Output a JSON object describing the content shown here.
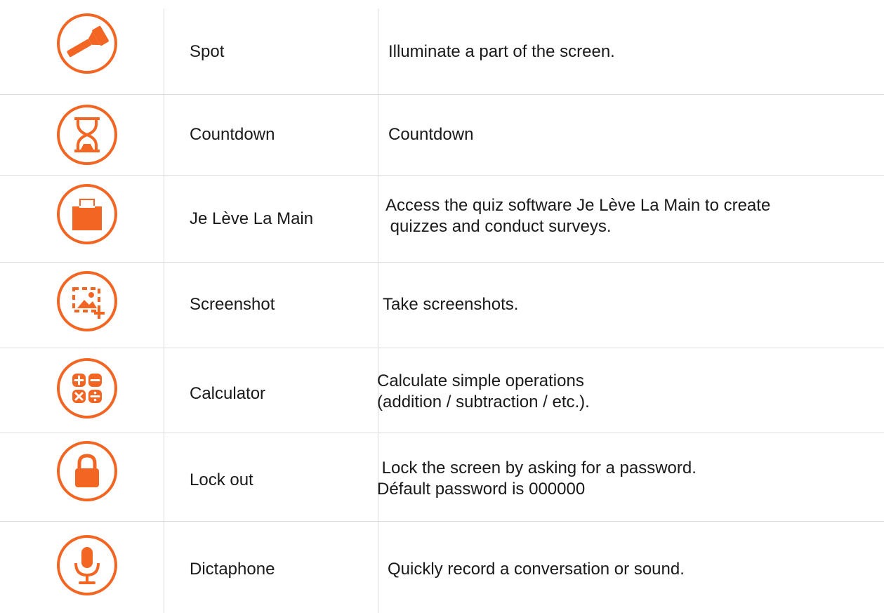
{
  "accent_color": "#f26522",
  "tools": [
    {
      "icon": "flashlight-icon",
      "name": "Spot",
      "description": "Illuminate a part of the screen."
    },
    {
      "icon": "hourglass-icon",
      "name": "Countdown",
      "description": "Countdown"
    },
    {
      "icon": "ballot-box-icon",
      "name": "Je Lève La Main",
      "description": "Access the quiz software Je Lève La Main to create\n quizzes and conduct surveys."
    },
    {
      "icon": "screenshot-icon",
      "name": "Screenshot",
      "description": "Take screenshots."
    },
    {
      "icon": "calculator-icon",
      "name": "Calculator",
      "description": "Calculate simple operations\n(addition / subtraction / etc.)."
    },
    {
      "icon": "lock-icon",
      "name": "Lock out",
      "description": " Lock the screen by asking for a password.\nDéfault password is 000000"
    },
    {
      "icon": "microphone-icon",
      "name": "Dictaphone",
      "description": "Quickly record a conversation or sound."
    }
  ]
}
